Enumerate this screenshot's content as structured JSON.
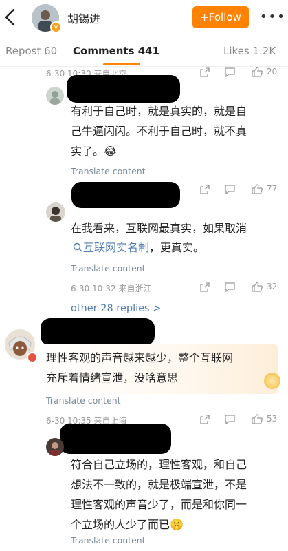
{
  "header": {
    "username": "胡锡进",
    "follow_label": "+Follow",
    "more_label": "•••"
  },
  "tabs": [
    {
      "label": "Repost 60"
    },
    {
      "label": "Comments 441"
    },
    {
      "label": "Likes 1.2K"
    }
  ],
  "replies": [
    {
      "meta": "6-30 10:30 来自北京",
      "likes": "20"
    },
    {
      "text_line1": "有利于自己时，就是真实的，就是自",
      "text_line2": "己牛逼闪闪。不利于自己时，就不真",
      "text_line3": "实了。😂",
      "translate": "Translate content",
      "likes": "77"
    },
    {
      "text_line1": "在我看来，互联网最真实，如果取消",
      "link_text": "互联网实名制",
      "text_line2_tail": "，更真实。",
      "translate": "Translate content",
      "meta": "6-30 10:32 来自浙江",
      "likes": "32"
    }
  ],
  "other_replies": "other 28 replies >",
  "main_comment": {
    "text_line1": "理性客观的声音越来越少，整个互联网",
    "text_line2": "充斥着情绪宣泄，没啥意思",
    "translate": "Translate content",
    "meta": "6-30 10:35 来自上海",
    "likes": "53"
  },
  "bottom_reply": {
    "text_line1": "符合自己立场的，理性客观，和自己",
    "text_line2": "想法不一致的，就是极端宣泄，不是",
    "text_line3": "理性客观的声音少了，而是和你同一",
    "text_line4": "个立场的人少了而已🤫",
    "translate": "Translate content"
  },
  "icons": [
    "back-icon",
    "verified-icon",
    "share-icon",
    "comment-icon",
    "like-icon",
    "search-icon",
    "vip-badge-icon"
  ],
  "colors": {
    "accent": "#ff8200",
    "link": "#507daf",
    "meta": "#999999"
  }
}
